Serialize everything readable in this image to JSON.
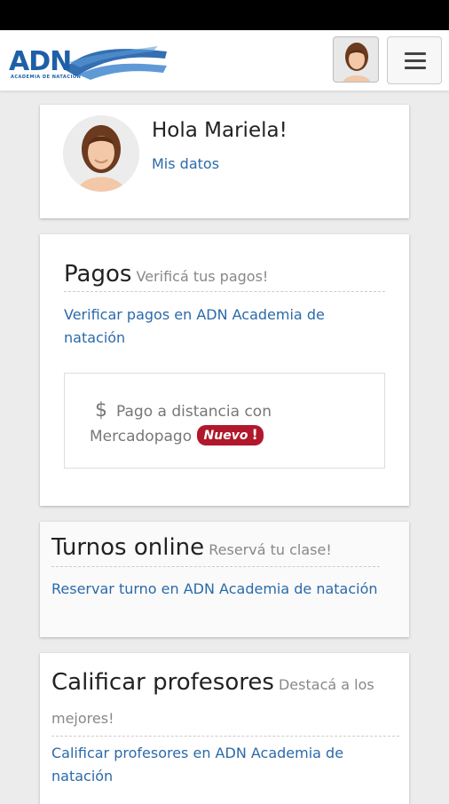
{
  "header": {
    "logo_text": "ADN",
    "logo_subtext": "ACADEMIA DE NATACIÓN",
    "avatar_icon": "user-avatar-icon",
    "menu_icon": "hamburger-menu-icon"
  },
  "profile": {
    "greeting": "Hola Mariela!",
    "my_data_link": "Mis datos"
  },
  "pagos": {
    "title": "Pagos",
    "subtitle": "Verificá tus pagos!",
    "link": "Verificar pagos en ADN Academia de natación",
    "mercadopago_icon": "$",
    "mercadopago_text": "Pago a distancia con Mercadopago",
    "badge": "Nuevo",
    "badge_icon": "!"
  },
  "turnos": {
    "title": "Turnos online",
    "subtitle": "Reservá tu clase!",
    "link": "Reservar turno en ADN Academia de natación"
  },
  "calificar": {
    "title": "Calificar profesores",
    "subtitle": "Destacá a los mejores!",
    "link": "Calificar profesores en ADN Academia de natación"
  },
  "colors": {
    "brand_blue": "#1e5fa8",
    "link_blue": "#2b6aa9",
    "badge_red": "#b0182b"
  }
}
